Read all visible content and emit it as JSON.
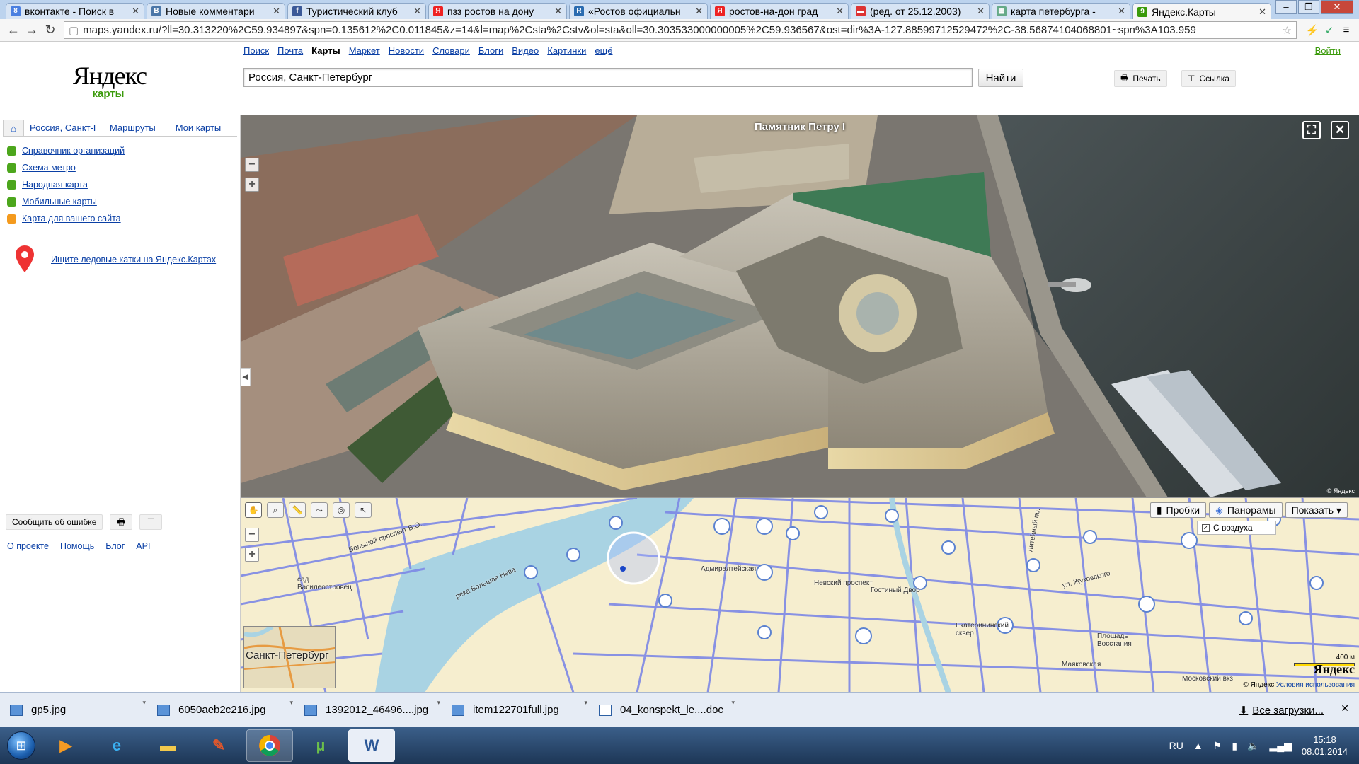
{
  "browser": {
    "tabs": [
      {
        "label": "вконтакте - Поиск в",
        "favicon": "google-favicon",
        "color": "#4a7fe0",
        "glyph": "8"
      },
      {
        "label": "Новые комментари",
        "favicon": "vk-favicon",
        "color": "#4a76a8",
        "glyph": "В"
      },
      {
        "label": "Туристический клуб",
        "favicon": "facebook-favicon",
        "color": "#3b5998",
        "glyph": "f"
      },
      {
        "label": "пзз ростов на дону",
        "favicon": "yandex-favicon",
        "color": "#e22",
        "glyph": "Я"
      },
      {
        "label": "«Ростов официальн",
        "favicon": "document-favicon",
        "color": "#2b6cb0",
        "glyph": "R"
      },
      {
        "label": "ростов-на-дон град",
        "favicon": "yandex-favicon",
        "color": "#e22",
        "glyph": "Я"
      },
      {
        "label": "(ред. от 25.12.2003)",
        "favicon": "flag-favicon",
        "color": "#d33",
        "glyph": "▬"
      },
      {
        "label": "карта петербурга -",
        "favicon": "photo-favicon",
        "color": "#6a8",
        "glyph": "▦"
      },
      {
        "label": "Яндекс.Карты",
        "favicon": "yandex-maps-favicon",
        "color": "#3a9a0a",
        "glyph": "9"
      }
    ],
    "url": "maps.yandex.ru/?ll=30.313220%2C59.934897&spn=0.135612%2C0.011845&z=14&l=map%2Csta%2Cstv&ol=sta&oll=30.303533000000005%2C59.936567&ost=dir%3A-127.88599712529472%2C-38.56874104068801~spn%3A103.959"
  },
  "header": {
    "logo_main": "Яндекс",
    "logo_sub": "карты",
    "services": [
      "Поиск",
      "Почта",
      "Карты",
      "Маркет",
      "Новости",
      "Словари",
      "Блоги",
      "Видео",
      "Картинки",
      "ещё"
    ],
    "current_service": "Карты",
    "login": "Войти",
    "search_value": "Россия, Санкт-Петербург",
    "search_button": "Найти",
    "print_label": "Печать",
    "link_label": "Ссылка"
  },
  "sidebar": {
    "tabs": [
      "Россия, Санкт-Г",
      "Маршруты",
      "Мои карты"
    ],
    "links": [
      "Справочник организаций",
      "Схема метро",
      "Народная карта",
      "Мобильные карты",
      "Карта для вашего сайта"
    ],
    "promo": "Ищите ледовые катки на Яндекс.Картах",
    "report_error": "Сообщить об ошибке",
    "footer": [
      "О проекте",
      "Помощь",
      "Блог",
      "API"
    ]
  },
  "panorama": {
    "title": "Памятник Петру I",
    "copyright": "© Яндекс"
  },
  "map": {
    "layers": [
      "Пробки",
      "Панорамы",
      "Показать ▾"
    ],
    "aerial_option": "С воздуха",
    "overview_label": "Санкт-Петербург",
    "scale": "400 м",
    "logo": "Яндекс",
    "copyright_prefix": "© Яндекс",
    "terms": "Условия использования",
    "labels": [
      "Большой проспект В.О.",
      "сад Василеостровец",
      "река Большая Нева",
      "Адмиралтейская",
      "Невский проспект",
      "Гостиный Двор",
      "Екатерининский сквер",
      "ул. Жуковского",
      "Площадь Восстания",
      "Маяковская",
      "Московский вкз",
      "Литейный пр."
    ]
  },
  "downloads": {
    "items": [
      "gp5.jpg",
      "6050aeb2c216.jpg",
      "1392012_46496....jpg",
      "item122701full.jpg",
      "04_konspekt_le....doc"
    ],
    "all": "Все загрузки..."
  },
  "taskbar": {
    "lang": "RU",
    "time": "15:18",
    "date": "08.01.2014"
  }
}
